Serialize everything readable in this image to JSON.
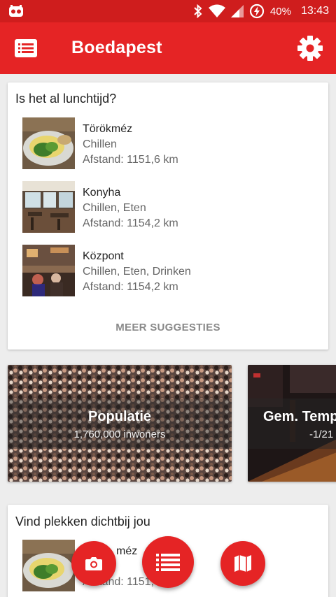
{
  "status_bar": {
    "battery": "40%",
    "time": "13:43"
  },
  "app_bar": {
    "title": "Boedapest"
  },
  "lunch_card": {
    "title": "Is het al lunchtijd?",
    "items": [
      {
        "name": "Törökméz",
        "categories": "Chillen",
        "distance": "Afstand: 1151,6 km"
      },
      {
        "name": "Konyha",
        "categories": "Chillen, Eten",
        "distance": "Afstand: 1154,2 km"
      },
      {
        "name": "Központ",
        "categories": "Chillen, Eten, Drinken",
        "distance": "Afstand: 1154,2 km"
      }
    ],
    "more_label": "MEER SUGGESTIES"
  },
  "stats": [
    {
      "title": "Populatie",
      "subtitle": "1,760,000 inwoners"
    },
    {
      "title": "Gem. Temp",
      "subtitle": "-1/21"
    }
  ],
  "nearby_card": {
    "title": "Vind plekken dichtbij jou",
    "item": {
      "name": "méz",
      "distance": "Afstand: 1151,"
    }
  },
  "colors": {
    "primary": "#e52425",
    "status_bar": "#cf1d1d",
    "background": "#ededed"
  }
}
